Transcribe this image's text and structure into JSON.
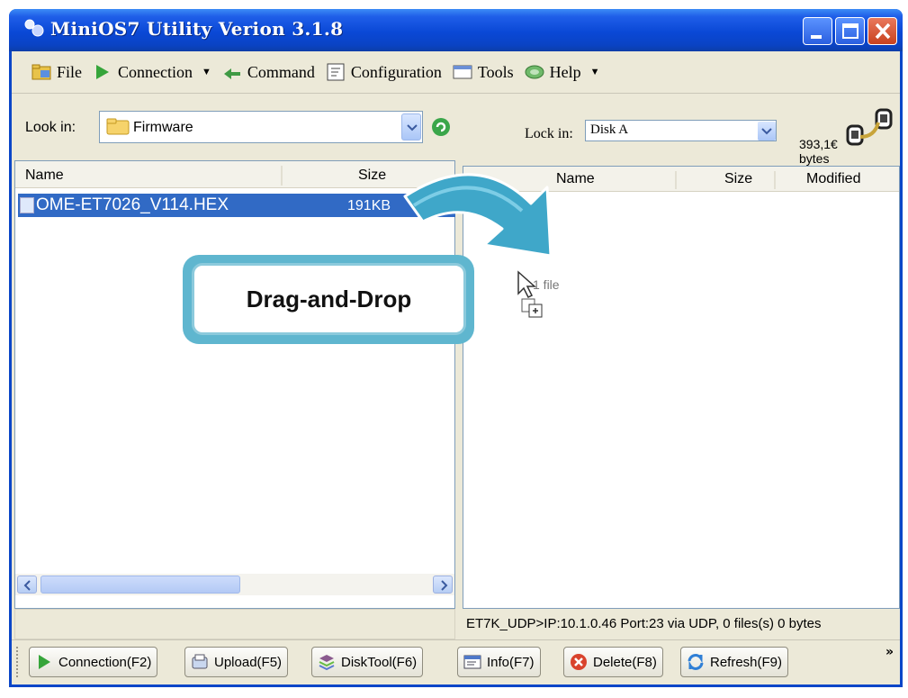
{
  "window": {
    "title": "MiniOS7 Utility Verion 3.1.8"
  },
  "menu": [
    {
      "label": "File",
      "icon": "folder-icon"
    },
    {
      "label": "Connection",
      "icon": "play-icon",
      "dropdown": true
    },
    {
      "label": "Command",
      "icon": "command-icon"
    },
    {
      "label": "Configuration",
      "icon": "config-icon"
    },
    {
      "label": "Tools",
      "icon": "tools-icon"
    },
    {
      "label": "Help",
      "icon": "help-icon",
      "dropdown": true
    }
  ],
  "left": {
    "look_in_label": "Look in:",
    "look_in_value": "Firmware",
    "columns": {
      "name": "Name",
      "size": "Size"
    },
    "files": [
      {
        "name": "OME-ET7026_V114.HEX",
        "size": "191KB",
        "type": "HEX"
      }
    ]
  },
  "right": {
    "look_in_label": "Lock in:",
    "look_in_value": "Disk A",
    "free_space": "393,1€",
    "free_space_unit": "bytes",
    "columns": {
      "name": "Name",
      "size": "Size",
      "modified": "Modified"
    },
    "drag_label": "1 file",
    "status": "ET7K_UDP>IP:10.1.0.46 Port:23 via UDP, 0 files(s) 0 bytes"
  },
  "callout": {
    "text": "Drag-and-Drop"
  },
  "toolbar": [
    {
      "label": "Connection(F2)",
      "icon": "play-icon"
    },
    {
      "label": "Upload(F5)",
      "icon": "upload-icon"
    },
    {
      "label": "DiskTool(F6)",
      "icon": "disk-icon"
    },
    {
      "label": "Info(F7)",
      "icon": "info-icon"
    },
    {
      "label": "Delete(F8)",
      "icon": "delete-icon"
    },
    {
      "label": "Refresh(F9)",
      "icon": "refresh-icon"
    }
  ],
  "toolbar_overflow": "»"
}
